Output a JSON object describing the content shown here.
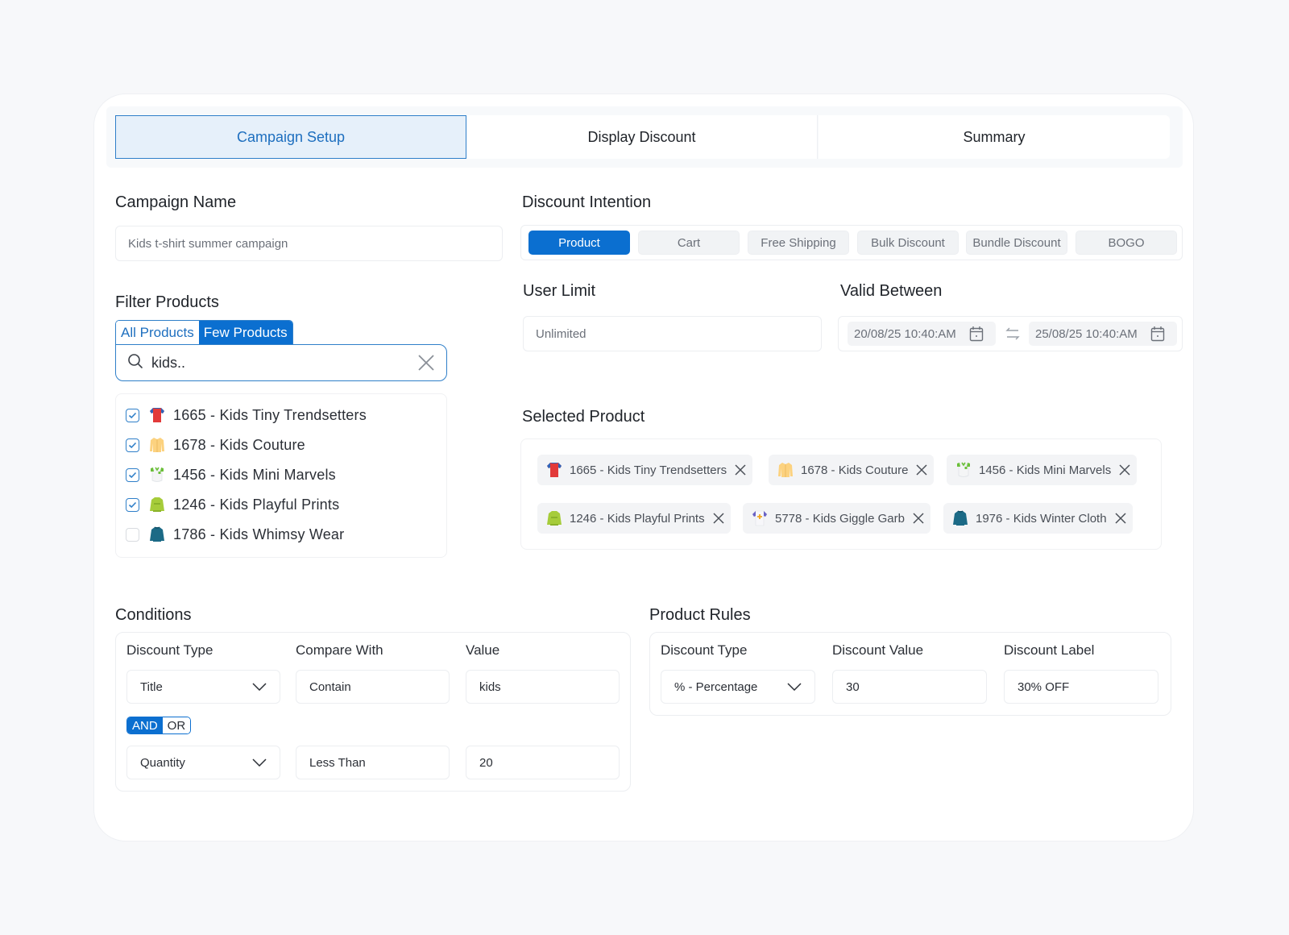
{
  "tabs": [
    {
      "label": "Campaign Setup",
      "active": true
    },
    {
      "label": "Display Discount",
      "active": false
    },
    {
      "label": "Summary",
      "active": false
    }
  ],
  "campaign_name": {
    "label": "Campaign Name",
    "placeholder": "Kids t-shirt summer campaign"
  },
  "discount_intention": {
    "label": "Discount Intention",
    "options": [
      "Product",
      "Cart",
      "Free Shipping",
      "Bulk Discount",
      "Bundle Discount",
      "BOGO"
    ],
    "selected": "Product"
  },
  "filter_products": {
    "label": "Filter Products",
    "toggle": [
      "All Products",
      "Few Products"
    ],
    "selected": "Few Products",
    "search_value": "kids..",
    "results": [
      {
        "label": "1665 - Kids Tiny Trendsetters",
        "checked": true,
        "icon": "red-tshirt-icon"
      },
      {
        "label": "1678 - Kids Couture",
        "checked": true,
        "icon": "yellow-shirt-icon"
      },
      {
        "label": "1456 - Kids Mini Marvels",
        "checked": true,
        "icon": "white-green-shirt-icon"
      },
      {
        "label": "1246 - Kids Playful Prints",
        "checked": true,
        "icon": "green-sweater-icon"
      },
      {
        "label": "1786 - Kids Whimsy Wear",
        "checked": false,
        "icon": "teal-sweater-icon"
      }
    ]
  },
  "user_limit": {
    "label": "User Limit",
    "placeholder": "Unlimited"
  },
  "valid_between": {
    "label": "Valid Between",
    "start": "20/08/25 10:40:AM",
    "end": "25/08/25 10:40:AM"
  },
  "selected_product": {
    "label": "Selected Product",
    "items": [
      {
        "label": "1665 - Kids Tiny Trendsetters",
        "icon": "red-tshirt-icon"
      },
      {
        "label": "1678 - Kids Couture",
        "icon": "yellow-shirt-icon"
      },
      {
        "label": "1456 - Kids Mini Marvels",
        "icon": "white-green-shirt-icon"
      },
      {
        "label": "1246 - Kids Playful Prints",
        "icon": "green-sweater-icon"
      },
      {
        "label": "5778 - Kids Giggle Garb",
        "icon": "white-purple-tshirt-icon"
      },
      {
        "label": "1976 - Kids Winter Cloth",
        "icon": "teal-sweater-icon"
      }
    ]
  },
  "conditions": {
    "label": "Conditions",
    "columns": [
      "Discount Type",
      "Compare With",
      "Value"
    ],
    "rows": [
      {
        "type": "Title",
        "compare": "Contain",
        "value": "kids"
      },
      {
        "type": "Quantity",
        "compare": "Less Than",
        "value": "20"
      }
    ],
    "logic": {
      "options": [
        "AND",
        "OR"
      ],
      "selected": "AND"
    }
  },
  "product_rules": {
    "label": "Product Rules",
    "columns": [
      "Discount Type",
      "Discount Value",
      "Discount Label"
    ],
    "discount_type": "% - Percentage",
    "discount_value": "30",
    "discount_label": "30% OFF"
  },
  "colors": {
    "accent": "#0b6fd0",
    "active_tab_bg": "#e6f0fa",
    "chip_bg": "#f3f4f6"
  }
}
